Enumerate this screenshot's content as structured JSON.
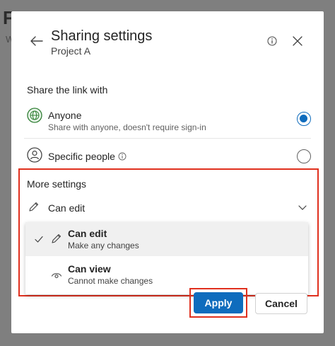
{
  "background": {
    "title_fragment": "F",
    "subtitle_fragment": "W"
  },
  "dialog": {
    "title": "Sharing settings",
    "subtitle": "Project A"
  },
  "share": {
    "section_label": "Share the link with",
    "options": [
      {
        "name": "Anyone",
        "description": "Share with anyone, doesn't require sign-in",
        "selected": true,
        "icon": "globe-icon"
      },
      {
        "name": "Specific people",
        "description": "",
        "selected": false,
        "icon": "person-icon"
      }
    ]
  },
  "more_settings": {
    "label": "More settings",
    "permission_value": "Can edit",
    "menu": [
      {
        "name": "Can edit",
        "description": "Make any changes",
        "checked": true,
        "icon": "pencil-icon"
      },
      {
        "name": "Can view",
        "description": "Cannot make changes",
        "checked": false,
        "icon": "eye-icon"
      }
    ]
  },
  "buttons": {
    "apply": "Apply",
    "cancel": "Cancel"
  },
  "colors": {
    "accent": "#0f6cbd",
    "highlight": "#e0301e"
  }
}
